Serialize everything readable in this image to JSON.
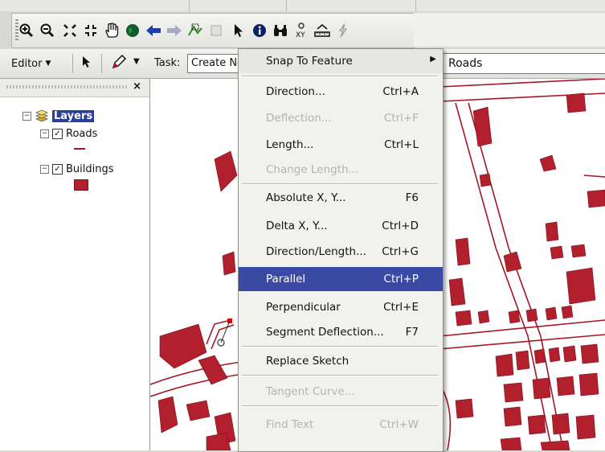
{
  "toolbar": {
    "icons": [
      "zoom-in-icon",
      "zoom-out-icon",
      "fixed-zoom-in-icon",
      "fixed-zoom-out-icon",
      "pan-icon",
      "full-extent-icon",
      "back-icon",
      "forward-icon",
      "select-features-icon",
      "clear-selection-icon",
      "select-elements-icon",
      "identify-icon",
      "find-icon",
      "go-to-xy-icon",
      "measure-icon",
      "hyperlink-icon"
    ]
  },
  "editor_toolbar": {
    "editor_label": "Editor",
    "task_label": "Task:",
    "task_value": "Create New Feature",
    "target_value": "Roads"
  },
  "toc": {
    "root": "Layers",
    "layers": [
      {
        "name": "Roads",
        "checked": true
      },
      {
        "name": "Buildings",
        "checked": true
      }
    ]
  },
  "context_menu": {
    "items": [
      {
        "label": "Snap To Feature",
        "shortcut": "",
        "submenu": true,
        "disabled": false
      },
      {
        "label": "Direction...",
        "shortcut": "Ctrl+A",
        "disabled": false
      },
      {
        "label": "Deflection...",
        "shortcut": "Ctrl+F",
        "disabled": true
      },
      {
        "label": "Length...",
        "shortcut": "Ctrl+L",
        "disabled": false
      },
      {
        "label": "Change Length...",
        "shortcut": "",
        "disabled": true
      },
      {
        "label": "Absolute X, Y...",
        "shortcut": "F6",
        "disabled": false
      },
      {
        "label": "Delta X, Y...",
        "shortcut": "Ctrl+D",
        "disabled": false
      },
      {
        "label": "Direction/Length...",
        "shortcut": "Ctrl+G",
        "disabled": false
      },
      {
        "label": "Parallel",
        "shortcut": "Ctrl+P",
        "disabled": false,
        "selected": true
      },
      {
        "label": "Perpendicular",
        "shortcut": "Ctrl+E",
        "disabled": false
      },
      {
        "label": "Segment Deflection...",
        "shortcut": "F7",
        "disabled": false
      },
      {
        "label": "Replace Sketch",
        "shortcut": "",
        "disabled": false
      },
      {
        "label": "Tangent Curve...",
        "shortcut": "",
        "disabled": true
      },
      {
        "label": "Find Text",
        "shortcut": "Ctrl+W",
        "disabled": true
      }
    ]
  },
  "colors": {
    "road": "#a31624",
    "building": "#b2202d",
    "selection": "#3a49a4"
  }
}
